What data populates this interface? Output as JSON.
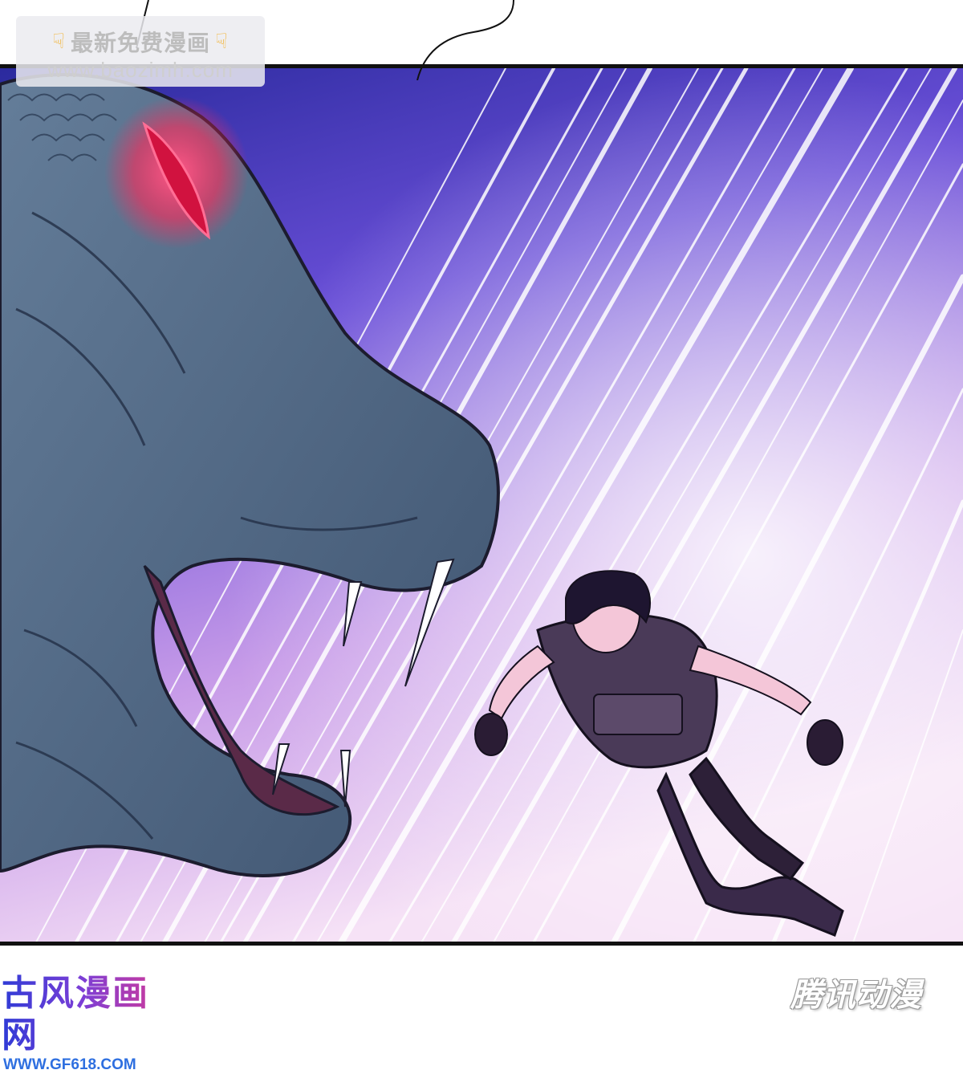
{
  "watermark": {
    "title": "最新免费漫画",
    "url": "www.baozimh.com",
    "icon": "pointing-down-hand-icon"
  },
  "brand_left": {
    "name": "古风漫画网",
    "url": "WWW.GF618.COM"
  },
  "brand_right": {
    "name": "腾讯动漫"
  },
  "colors": {
    "sky_top": "#3a2fb0",
    "sky_mid": "#8f5ee0",
    "sky_bottom": "#f3d4f2",
    "monster_skin": "#5a6f8c",
    "monster_eye": "#ff2a5a",
    "character_outfit": "#3a2a4a"
  }
}
